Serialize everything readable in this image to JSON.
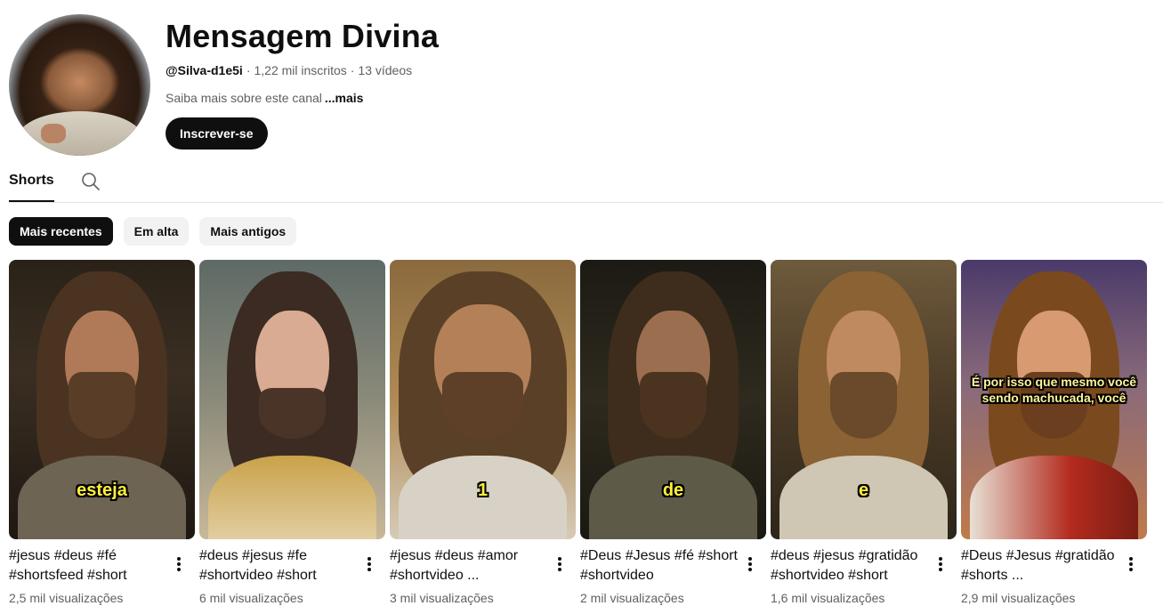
{
  "channel": {
    "title": "Mensagem Divina",
    "handle": "@Silva-d1e5i",
    "subscribers": "1,22 mil inscritos",
    "videos": "13 vídeos",
    "description": "Saiba mais sobre este canal",
    "more": "...mais",
    "subscribe_label": "Inscrever-se"
  },
  "tabs": [
    {
      "label": "Shorts",
      "active": true
    }
  ],
  "icons": {
    "search": "search-icon",
    "menu": "more-vert-icon"
  },
  "chips": [
    {
      "label": "Mais recentes",
      "active": true
    },
    {
      "label": "Em alta",
      "active": false
    },
    {
      "label": "Mais antigos",
      "active": false
    }
  ],
  "shorts": [
    {
      "title": "#jesus #deus #fé #shortsfeed #short",
      "views": "2,5 mil visualizações",
      "caption": "esteja"
    },
    {
      "title": "#deus #jesus #fe #shortvideo #short",
      "views": "6 mil visualizações",
      "caption": ""
    },
    {
      "title": "#jesus #deus #amor #shortvideo ...",
      "views": "3 mil visualizações",
      "caption": "1"
    },
    {
      "title": "#Deus #Jesus #fé #short #shortvideo",
      "views": "2 mil visualizações",
      "caption": "de"
    },
    {
      "title": "#deus #jesus #gratidão #shortvideo #short",
      "views": "1,6 mil visualizações",
      "caption": "e"
    },
    {
      "title": "#Deus #Jesus #gratidão #shorts ...",
      "views": "2,9 mil visualizações",
      "caption": "É por isso que mesmo você sendo machucada, você"
    }
  ],
  "colors": {
    "text": "#0f0f0f",
    "secondary": "#606060",
    "chip_bg": "#f2f2f2",
    "caption": "#ffef3a"
  }
}
